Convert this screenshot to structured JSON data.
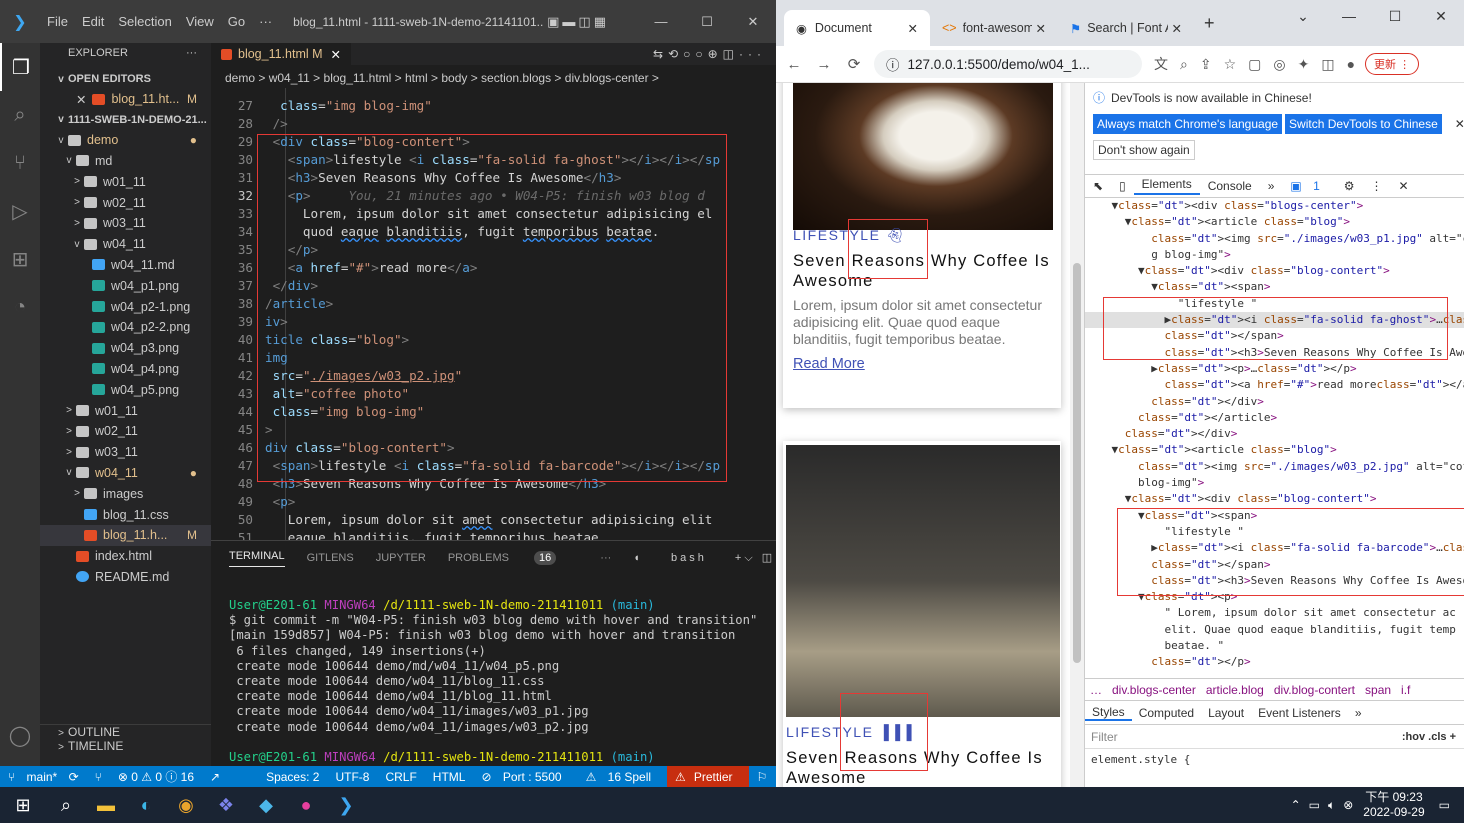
{
  "vscode": {
    "menu": [
      "File",
      "Edit",
      "Selection",
      "View",
      "Go",
      "···"
    ],
    "window_title": "blog_11.html - 1111-sweb-1N-demo-21141101...",
    "explorer_label": "EXPLORER",
    "open_editors": "OPEN EDITORS",
    "open_file": "blog_11.ht...",
    "open_file_state": "M",
    "workspace": "1111-SWEB-1N-DEMO-21...",
    "tree": [
      {
        "name": "demo",
        "kind": "folder",
        "level": 1,
        "twisty": "v",
        "state": "●"
      },
      {
        "name": "md",
        "kind": "folder",
        "level": 2,
        "twisty": "v",
        "state": ""
      },
      {
        "name": "w01_11",
        "kind": "folder",
        "level": 3,
        "twisty": ">",
        "state": ""
      },
      {
        "name": "w02_11",
        "kind": "folder",
        "level": 3,
        "twisty": ">",
        "state": ""
      },
      {
        "name": "w03_11",
        "kind": "folder",
        "level": 3,
        "twisty": ">",
        "state": ""
      },
      {
        "name": "w04_11",
        "kind": "folder",
        "level": 3,
        "twisty": "v",
        "state": ""
      },
      {
        "name": "w04_11.md",
        "kind": "md",
        "level": 4,
        "twisty": "",
        "state": ""
      },
      {
        "name": "w04_p1.png",
        "kind": "png",
        "level": 4,
        "twisty": "",
        "state": ""
      },
      {
        "name": "w04_p2-1.png",
        "kind": "png",
        "level": 4,
        "twisty": "",
        "state": ""
      },
      {
        "name": "w04_p2-2.png",
        "kind": "png",
        "level": 4,
        "twisty": "",
        "state": ""
      },
      {
        "name": "w04_p3.png",
        "kind": "png",
        "level": 4,
        "twisty": "",
        "state": ""
      },
      {
        "name": "w04_p4.png",
        "kind": "png",
        "level": 4,
        "twisty": "",
        "state": ""
      },
      {
        "name": "w04_p5.png",
        "kind": "png",
        "level": 4,
        "twisty": "",
        "state": ""
      },
      {
        "name": "w01_11",
        "kind": "folder",
        "level": 2,
        "twisty": ">",
        "state": ""
      },
      {
        "name": "w02_11",
        "kind": "folder",
        "level": 2,
        "twisty": ">",
        "state": ""
      },
      {
        "name": "w03_11",
        "kind": "folder",
        "level": 2,
        "twisty": ">",
        "state": ""
      },
      {
        "name": "w04_11",
        "kind": "folder",
        "level": 2,
        "twisty": "v",
        "state": "●"
      },
      {
        "name": "images",
        "kind": "folder",
        "level": 3,
        "twisty": ">",
        "state": ""
      },
      {
        "name": "blog_11.css",
        "kind": "css",
        "level": 3,
        "twisty": "",
        "state": ""
      },
      {
        "name": "blog_11.h...",
        "kind": "html",
        "level": 3,
        "twisty": "",
        "state": "M"
      },
      {
        "name": "index.html",
        "kind": "html",
        "level": 2,
        "twisty": "",
        "state": ""
      },
      {
        "name": "README.md",
        "kind": "info",
        "level": 2,
        "twisty": "",
        "state": ""
      }
    ],
    "outline": "OUTLINE",
    "timeline": "TIMELINE",
    "tab_label": "blog_11.html M",
    "breadcrumb": "demo > w04_11 > blog_11.html > html > body > section.blogs > div.blogs-center >",
    "line_numbers": [
      "27",
      "28",
      "29",
      "30",
      "31",
      "32",
      "33",
      "34",
      "35",
      "36",
      "37",
      "38",
      "39",
      "40",
      "41",
      "42",
      "43",
      "44",
      "45",
      "46",
      "47",
      "48",
      "49",
      "50",
      "51"
    ],
    "blame": "You, 21 minutes ago • W04-P5: finish w03 blog d",
    "panel_tabs": [
      "TERMINAL",
      "GITLENS",
      "JUPYTER",
      "PROBLEMS"
    ],
    "problems_count": "16",
    "shell": "bash",
    "terminal": {
      "user": "User@E201-61",
      "env": "MINGW64",
      "path": "/d/1111-sweb-1N-demo-211411011",
      "branch": "(main)",
      "command": "$ git commit -m \"W04-P5: finish w03 blog demo with hover and transition\"",
      "out": [
        "[main 159d857] W04-P5: finish w03 blog demo with hover and transition",
        " 6 files changed, 149 insertions(+)",
        " create mode 100644 demo/md/w04_11/w04_p5.png",
        " create mode 100644 demo/w04_11/blog_11.css",
        " create mode 100644 demo/w04_11/blog_11.html",
        " create mode 100644 demo/w04_11/images/w03_p1.jpg",
        " create mode 100644 demo/w04_11/images/w03_p2.jpg"
      ]
    },
    "status": {
      "branch": "main*",
      "problems": "⊗ 0 ⚠ 0 ⓘ 16",
      "spaces": "Spaces: 2",
      "encoding": "UTF-8",
      "eol": "CRLF",
      "lang": "HTML",
      "port": "Port : 5500",
      "spell": "16 Spell",
      "prettier": "Prettier"
    }
  },
  "chrome": {
    "tabs": [
      "Document",
      "font-awesome",
      "Search | Font A"
    ],
    "url": "127.0.0.1:5500/demo/w04_1...",
    "update": "更新",
    "cards": [
      {
        "kind": "LIFESTYLE",
        "title": "Seven Reasons Why Coffee Is Awesome",
        "text": "Lorem, ipsum dolor sit amet consectetur adipisicing elit. Quae quod eaque blanditiis, fugit temporibus beatae.",
        "link": "Read More"
      },
      {
        "kind": "LIFESTYLE",
        "title": "Seven Reasons Why Coffee Is Awesome"
      }
    ],
    "devtools": {
      "banner": "DevTools is now available in Chinese!",
      "btn_match": "Always match Chrome's language",
      "btn_switch": "Switch DevTools to Chinese",
      "btn_dont": "Don't show again",
      "tabs": [
        "Elements",
        "Console"
      ],
      "badge": "1",
      "dom_lines": [
        "    ▼<div class=\"blogs-center\">",
        "      ▼<article class=\"blog\">",
        "          <img src=\"./images/w03_p1.jpg\" alt=\"coffee pho",
        "          g blog-img\">",
        "        ▼<div class=\"blog-contert\">",
        "          ▼<span>",
        "              \"lifestyle \"",
        "            ▶<i class=\"fa-solid fa-ghost\">…</i> == $0",
        "            </span>",
        "            <h3>Seven Reasons Why Coffee Is Awesome</h3>",
        "          ▶<p>…</p>",
        "            <a href=\"#\">read more</a>",
        "          </div>",
        "        </article>",
        "      </div>",
        "    ▼<article class=\"blog\">",
        "        <img src=\"./images/w03_p2.jpg\" alt=\"coffee phot",
        "        blog-img\">",
        "      ▼<div class=\"blog-contert\">",
        "        ▼<span>",
        "            \"lifestyle \"",
        "          ▶<i class=\"fa-solid fa-barcode\">…</i>",
        "          </span>",
        "          <h3>Seven Reasons Why Coffee Is Awesome</h3>",
        "        ▼<p>",
        "            \" Lorem, ipsum dolor sit amet consectetur ac",
        "            elit. Quae quod eaque blanditiis, fugit temp",
        "            beatae. \"",
        "          </p>"
      ],
      "crumbs": [
        "div.blogs-center",
        "article.blog",
        "div.blog-contert",
        "span",
        "i.f"
      ],
      "style_tabs": [
        "Styles",
        "Computed",
        "Layout",
        "Event Listeners"
      ],
      "filter": "Filter",
      "filter_right": ":hov .cls +",
      "element_style": "element.style {"
    }
  },
  "taskbar": {
    "time": "下午 09:23",
    "date": "2022-09-29"
  }
}
